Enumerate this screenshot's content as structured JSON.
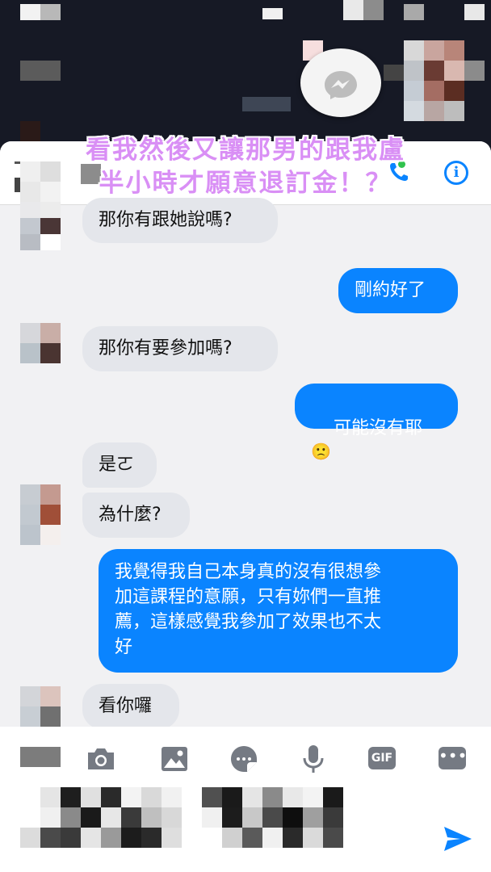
{
  "overlay": {
    "caption_line1": "看我然後又讓那男的跟我盧",
    "caption_line2": "半小時才願意退訂金！？"
  },
  "header": {
    "info_icon": "info-icon",
    "call_icon": "phone-icon"
  },
  "messages": [
    {
      "side": "in",
      "text": "那你有跟她說嗎?"
    },
    {
      "side": "out",
      "text": "剛約好了"
    },
    {
      "side": "in",
      "text": "那你有要參加嗎?"
    },
    {
      "side": "out",
      "text": "可能沒有耶",
      "emoji": "🙁"
    },
    {
      "side": "in",
      "text": "是ㄛ"
    },
    {
      "side": "in",
      "text": "為什麼?"
    },
    {
      "side": "out",
      "text": "我覺得我自己本身真的沒有很想參\n加這課程的意願，只有妳們一直推\n薦，這樣感覺我參加了效果也不太\n好"
    },
    {
      "side": "in",
      "text": "看你囉"
    }
  ],
  "composer": {
    "tools": [
      "camera-icon",
      "image-icon",
      "sticker-icon",
      "microphone-icon",
      "gif-button",
      "more-icon"
    ],
    "gif_label": "GIF",
    "more_label": "•••",
    "send_icon": "send-icon"
  },
  "colors": {
    "accent": "#0a84ff",
    "incoming_bubble": "#e4e6eb",
    "caption": "#d98ff5"
  }
}
